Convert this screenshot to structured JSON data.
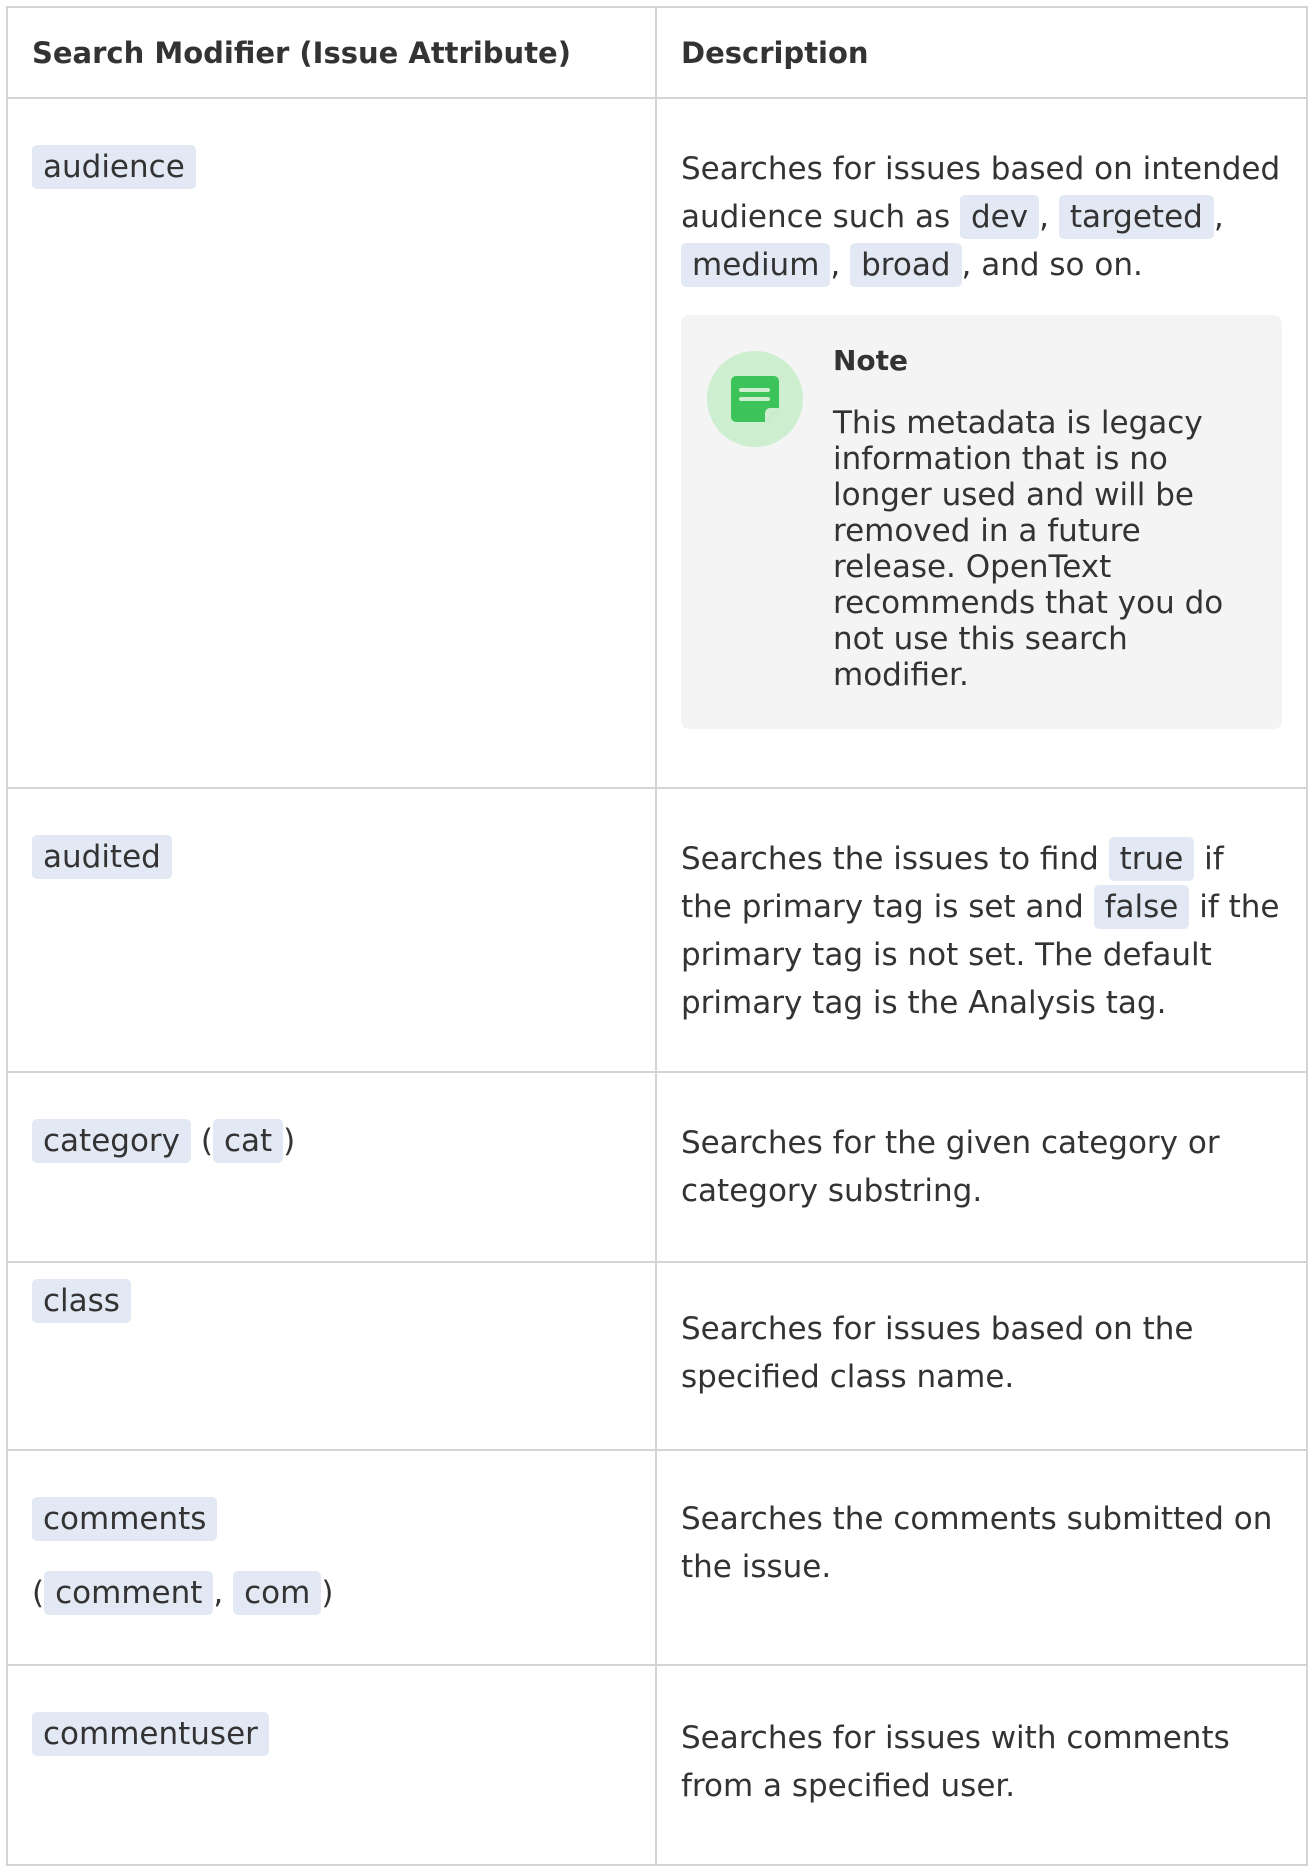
{
  "table": {
    "headers": {
      "modifier": "Search Modifier (Issue Attribute)",
      "description": "Description"
    },
    "rows": {
      "audience": {
        "modifier": "audience",
        "desc_1": "Searches for issues based on intended audience such as ",
        "code_1": "dev",
        "sep_1": ", ",
        "code_2": "targeted",
        "sep_2": ", ",
        "code_3": "medium",
        "sep_3": ", ",
        "code_4": "broad",
        "desc_end": ", and so on.",
        "note": {
          "icon": "note-icon",
          "title": "Note",
          "body": "This metadata is legacy information that is no longer used and will be removed in a future release. OpenText recommends that you do not use this search modifier."
        }
      },
      "audited": {
        "modifier": "audited",
        "desc_1": "Searches the issues to find ",
        "code_1": "true",
        "desc_2": " if the primary tag is set and ",
        "code_2": "false",
        "desc_3": " if the primary tag is not set. The default primary tag is the Analysis tag."
      },
      "category": {
        "modifier": "category",
        "open": " (",
        "alias": "cat",
        "close": ")",
        "description": "Searches for the given category or category substring."
      },
      "class": {
        "modifier": "class",
        "description": "Searches for issues based on the specified class name."
      },
      "comments": {
        "modifier": "comments",
        "open": "(",
        "alias_1": "comment",
        "sep": ", ",
        "alias_2": "com",
        "close": ")",
        "description": "Searches the comments submitted on the issue."
      },
      "commentuser": {
        "modifier": "commentuser",
        "description": "Searches for issues with comments from a specified user."
      }
    }
  },
  "colors": {
    "code_bg": "#e3e9f4",
    "note_bg": "#f4f4f4",
    "note_icon_bg": "#cdeecf",
    "note_icon_fg": "#3cc35a",
    "border": "#d4d4d4",
    "text": "#333333"
  }
}
